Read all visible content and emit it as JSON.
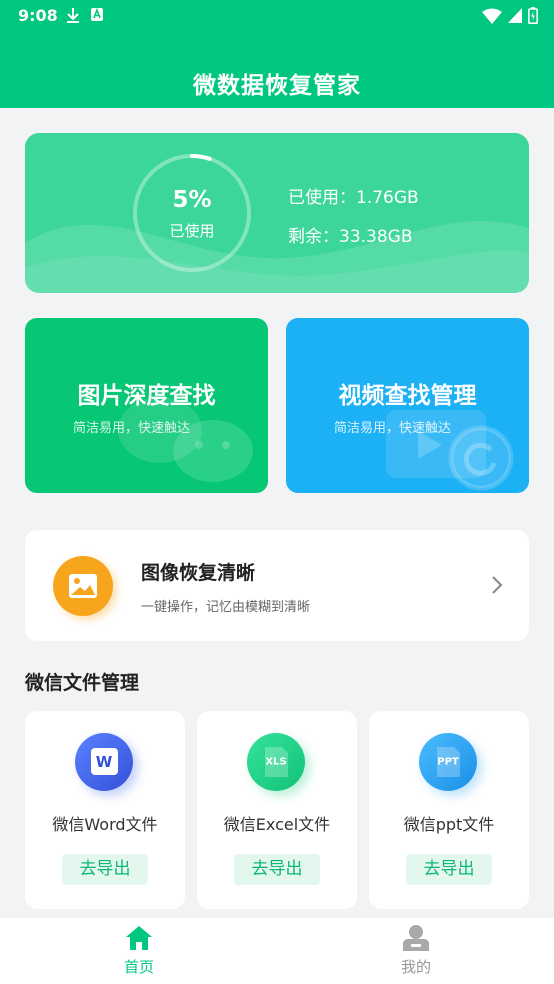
{
  "status_bar": {
    "time": "9:08"
  },
  "header": {
    "title": "微数据恢复管家"
  },
  "storage": {
    "percent_text": "5%",
    "percent_label": "已使用",
    "used_fraction": 0.05,
    "used_text": "已使用：1.76GB",
    "free_text": "剩余：33.38GB"
  },
  "features": [
    {
      "title": "图片深度查找",
      "subtitle": "简洁易用，快速触达",
      "color": "#07c775"
    },
    {
      "title": "视频查找管理",
      "subtitle": "简洁易用，快速触达",
      "color": "#1cb0f5"
    }
  ],
  "restore": {
    "title": "图像恢复清晰",
    "subtitle": "一键操作，记忆由模糊到清晰"
  },
  "wechat_files": {
    "section_title": "微信文件管理",
    "items": [
      {
        "label": "微信Word文件",
        "icon_text": "W",
        "button": "去导出",
        "color": "#3d63e8"
      },
      {
        "label": "微信Excel文件",
        "icon_text": "XLS",
        "button": "去导出",
        "color": "#1fcf85"
      },
      {
        "label": "微信ppt文件",
        "icon_text": "PPT",
        "button": "去导出",
        "color": "#27a3f0"
      }
    ]
  },
  "tabs": [
    {
      "label": "首页",
      "active": true
    },
    {
      "label": "我的",
      "active": false
    }
  ],
  "colors": {
    "accent": "#00c77f",
    "inactive": "#999999"
  }
}
